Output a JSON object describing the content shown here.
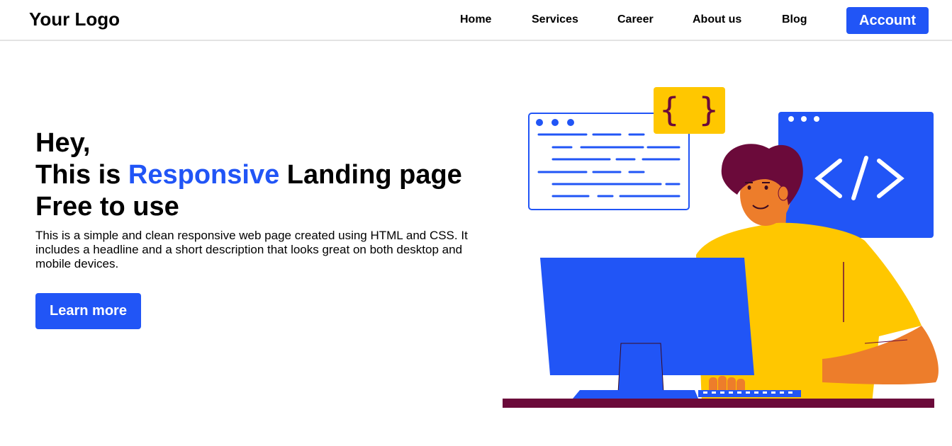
{
  "nav": {
    "logo": "Your Logo",
    "links": [
      "Home",
      "Services",
      "Career",
      "About us",
      "Blog"
    ],
    "account_label": "Account"
  },
  "hero": {
    "headline_line1": "Hey,",
    "headline_prefix": "This is ",
    "headline_accent": "Responsive",
    "headline_suffix": " Landing page Free to use",
    "description": "This is a simple and clean responsive web page created using HTML and CSS. It includes a headline and a short description that looks great on both desktop and mobile devices.",
    "cta_label": "Learn more"
  },
  "colors": {
    "accent": "#2155f6",
    "yellow": "#ffc700",
    "orange": "#ed7d2b",
    "maroon": "#6b0a3a"
  },
  "illustration": {
    "icons": [
      "curly-braces-icon",
      "code-slash-icon"
    ],
    "curly_braces_text": "{ }"
  }
}
